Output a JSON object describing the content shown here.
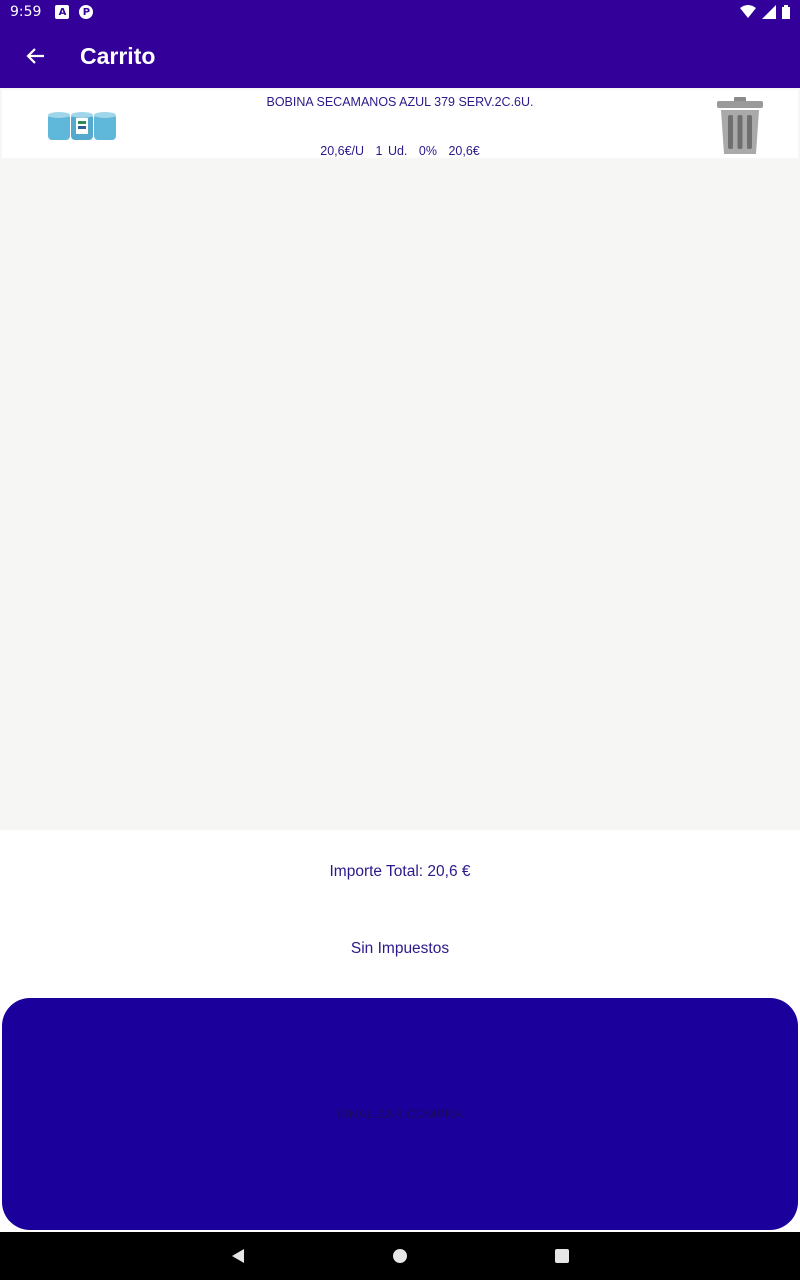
{
  "status_bar": {
    "time": "9:59",
    "icons": [
      "a-notification-icon",
      "p-notification-icon",
      "wifi-icon",
      "signal-icon",
      "battery-icon"
    ]
  },
  "app_bar": {
    "title": "Carrito",
    "back_icon": "arrow-left-icon"
  },
  "cart": {
    "items": [
      {
        "name": "BOBINA SECAMANOS AZUL 379 SERV.2C.6U.",
        "unit_price": "20,6€/U",
        "quantity": "1 Ud.",
        "discount": "0%",
        "subtotal": "20,6€",
        "image_icon": "paper-towel-rolls-icon",
        "delete_icon": "trash-icon"
      }
    ]
  },
  "summary": {
    "total": "Importe Total: 20,6 €",
    "tax_note": "Sin Impuestos"
  },
  "finish_button": {
    "label": "FINALIZAR COMPRA"
  },
  "colors": {
    "primary": "#33009a",
    "button": "#1b009b",
    "text": "#2a1a8a",
    "background": "#f6f6f5"
  },
  "nav_bar": {
    "icons": [
      "back-triangle-icon",
      "home-circle-icon",
      "recents-square-icon"
    ]
  }
}
